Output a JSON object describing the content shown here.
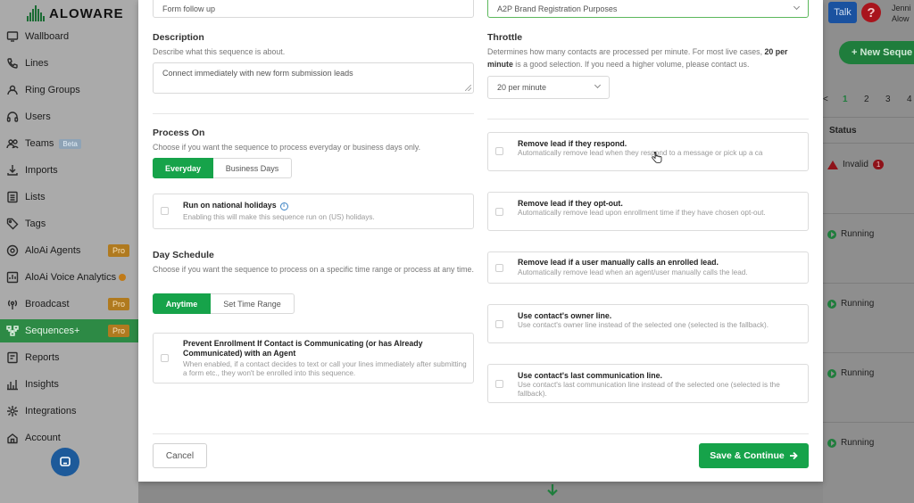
{
  "app": {
    "brand": "ALOWARE"
  },
  "sidebar": {
    "items": [
      {
        "label": "Wallboard",
        "icon": "wallboard-icon"
      },
      {
        "label": "Lines",
        "icon": "phone-icon"
      },
      {
        "label": "Ring Groups",
        "icon": "ring-groups-icon"
      },
      {
        "label": "Users",
        "icon": "headset-icon"
      },
      {
        "label": "Teams",
        "icon": "teams-icon",
        "badge": "Beta"
      },
      {
        "label": "Imports",
        "icon": "import-icon"
      },
      {
        "label": "Lists",
        "icon": "list-icon"
      },
      {
        "label": "Tags",
        "icon": "tag-icon"
      },
      {
        "label": "AloAi Agents",
        "icon": "ai-agent-icon",
        "badge": "Pro"
      },
      {
        "label": "AloAi Voice Analytics",
        "icon": "voice-analytics-icon"
      },
      {
        "label": "Broadcast",
        "icon": "broadcast-icon",
        "badge": "Pro"
      },
      {
        "label": "Sequences+",
        "icon": "sequences-icon",
        "badge": "Pro",
        "active": true
      },
      {
        "label": "Reports",
        "icon": "reports-icon"
      },
      {
        "label": "Insights",
        "icon": "insights-icon"
      },
      {
        "label": "Integrations",
        "icon": "integrations-icon"
      },
      {
        "label": "Account",
        "icon": "account-icon"
      }
    ]
  },
  "header": {
    "talk_label": "Talk",
    "help_label": "?",
    "user_line1": "Jenni",
    "user_line2": "Alow"
  },
  "background": {
    "new_sequence_label": "+ New Seque",
    "pagination": [
      "<",
      "1",
      "2",
      "3",
      "4"
    ],
    "status_header": "Status",
    "rows": [
      {
        "status": "Invalid",
        "count": "1"
      },
      {
        "status": "Running"
      },
      {
        "status": "Running"
      },
      {
        "status": "Running"
      },
      {
        "status": "Running"
      }
    ]
  },
  "form": {
    "name_value": "Form follow up",
    "a2p_value": "A2P Brand Registration Purposes",
    "description": {
      "title": "Description",
      "desc": "Describe what this sequence is about.",
      "value": "Connect immediately with new form submission leads"
    },
    "throttle": {
      "title": "Throttle",
      "desc_part1": "Determines how many contacts are processed per minute. For most live cases, ",
      "desc_bold": "20 per minute",
      "desc_part2": " is a good selection. If you need a higher volume, please contact us.",
      "value": "20 per minute"
    },
    "process_on": {
      "title": "Process On",
      "desc": "Choose if you want the sequence to process everyday or business days only.",
      "options": [
        "Everyday",
        "Business Days"
      ],
      "selected": "Everyday"
    },
    "holidays": {
      "title": "Run on national holidays",
      "desc": "Enabling this will make this sequence run on (US) holidays.",
      "checked": false
    },
    "day_schedule": {
      "title": "Day Schedule",
      "desc": "Choose if you want the sequence to process on a specific time range or process at any time.",
      "options": [
        "Anytime",
        "Set Time Range"
      ],
      "selected": "Anytime"
    },
    "prevent_enrollment": {
      "title": "Prevent Enrollment If Contact is Communicating (or has Already Communicated) with an Agent",
      "desc": "When enabled, if a contact decides to text or call your lines immediately after submitting a form etc., they won't be enrolled into this sequence.",
      "checked": false
    },
    "options": [
      {
        "title": "Remove lead if they respond.",
        "desc": "Automatically remove lead when they respond to a message or pick up a ca",
        "checked": false
      },
      {
        "title": "Remove lead if they opt-out.",
        "desc": "Automatically remove lead upon enrollment time if they have chosen opt-out.",
        "checked": false
      },
      {
        "title": "Remove lead if a user manually calls an enrolled lead.",
        "desc": "Automatically remove lead when an agent/user manually calls the lead.",
        "checked": false
      },
      {
        "title": "Use contact's owner line.",
        "desc": "Use contact's owner line instead of the selected one (selected is the fallback).",
        "checked": false
      },
      {
        "title": "Use contact's last communication line.",
        "desc": "Use contact's last communication line instead of the selected one (selected is the fallback).",
        "checked": false
      }
    ],
    "cancel_label": "Cancel",
    "save_label": "Save & Continue"
  },
  "colors": {
    "accent": "#16a34a",
    "active_nav": "#2d8a45",
    "pro_badge": "#b07a1f",
    "danger": "#a8141c",
    "talk": "#1a52a0"
  }
}
